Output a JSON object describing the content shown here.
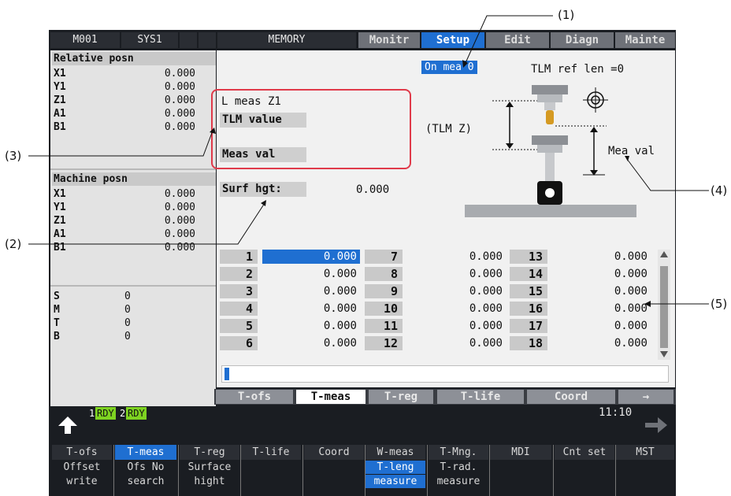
{
  "header": {
    "cells": [
      "M001",
      "SYS1",
      "",
      "MEMORY"
    ],
    "tabs": [
      "Monitr",
      "Setup",
      "Edit",
      "Diagn",
      "Mainte"
    ]
  },
  "left_panel": {
    "relative": {
      "title": "Relative posn",
      "rows": [
        {
          "axis": "X1",
          "value": "0.000"
        },
        {
          "axis": "Y1",
          "value": "0.000"
        },
        {
          "axis": "Z1",
          "value": "0.000"
        },
        {
          "axis": "A1",
          "value": "0.000"
        },
        {
          "axis": "B1",
          "value": "0.000"
        }
      ]
    },
    "machine": {
      "title": "Machine posn",
      "rows": [
        {
          "axis": "X1",
          "value": "0.000"
        },
        {
          "axis": "Y1",
          "value": "0.000"
        },
        {
          "axis": "Z1",
          "value": "0.000"
        },
        {
          "axis": "A1",
          "value": "0.000"
        },
        {
          "axis": "B1",
          "value": "0.000"
        }
      ]
    },
    "codes": [
      {
        "label": "S",
        "value": "0"
      },
      {
        "label": "M",
        "value": "0"
      },
      {
        "label": "T",
        "value": "0"
      },
      {
        "label": "B",
        "value": "0"
      }
    ]
  },
  "measure": {
    "mode_badge": "On mea 0",
    "ref_len": "TLM ref len =0",
    "l_meas": "L meas Z1",
    "tlm_value_label": "TLM value",
    "meas_val_label": "Meas val",
    "tlm_z": "(TLM Z)",
    "mea_val": "Mea val",
    "surf_hgt_label": "Surf hgt:",
    "surf_hgt_value": "0.000"
  },
  "offset_table": {
    "columns": [
      [
        {
          "no": "1",
          "val": "0.000"
        },
        {
          "no": "2",
          "val": "0.000"
        },
        {
          "no": "3",
          "val": "0.000"
        },
        {
          "no": "4",
          "val": "0.000"
        },
        {
          "no": "5",
          "val": "0.000"
        },
        {
          "no": "6",
          "val": "0.000"
        }
      ],
      [
        {
          "no": "7",
          "val": "0.000"
        },
        {
          "no": "8",
          "val": "0.000"
        },
        {
          "no": "9",
          "val": "0.000"
        },
        {
          "no": "10",
          "val": "0.000"
        },
        {
          "no": "11",
          "val": "0.000"
        },
        {
          "no": "12",
          "val": "0.000"
        }
      ],
      [
        {
          "no": "13",
          "val": "0.000"
        },
        {
          "no": "14",
          "val": "0.000"
        },
        {
          "no": "15",
          "val": "0.000"
        },
        {
          "no": "16",
          "val": "0.000"
        },
        {
          "no": "17",
          "val": "0.000"
        },
        {
          "no": "18",
          "val": "0.000"
        }
      ]
    ]
  },
  "screen_tabs": [
    "T-ofs",
    "T-meas",
    "T-reg",
    "T-life",
    "Coord",
    "→"
  ],
  "status": {
    "rdy1_num": "1",
    "rdy1": "RDY",
    "rdy2_num": "2",
    "rdy2": "RDY",
    "time": "11:10"
  },
  "menu": {
    "main": [
      "T-ofs",
      "T-meas",
      "T-reg",
      "T-life",
      "Coord",
      "W-meas",
      "T-Mng.",
      "MDI",
      "Cnt set",
      "MST"
    ],
    "sub": [
      [
        "Offset",
        "write"
      ],
      [
        "Ofs No",
        "search"
      ],
      [
        "Surface",
        "hight"
      ],
      [
        "",
        ""
      ],
      [
        "",
        ""
      ],
      [
        "T-leng",
        "measure"
      ],
      [
        "T-rad.",
        "measure"
      ],
      [
        "",
        ""
      ],
      [
        "",
        ""
      ],
      [
        "",
        ""
      ]
    ]
  },
  "callouts": [
    "(1)",
    "(2)",
    "(3)",
    "(4)",
    "(5)"
  ],
  "colors": {
    "accent": "#1f6fd1",
    "highlight": "#e03a4a",
    "ready": "#7ed321"
  }
}
